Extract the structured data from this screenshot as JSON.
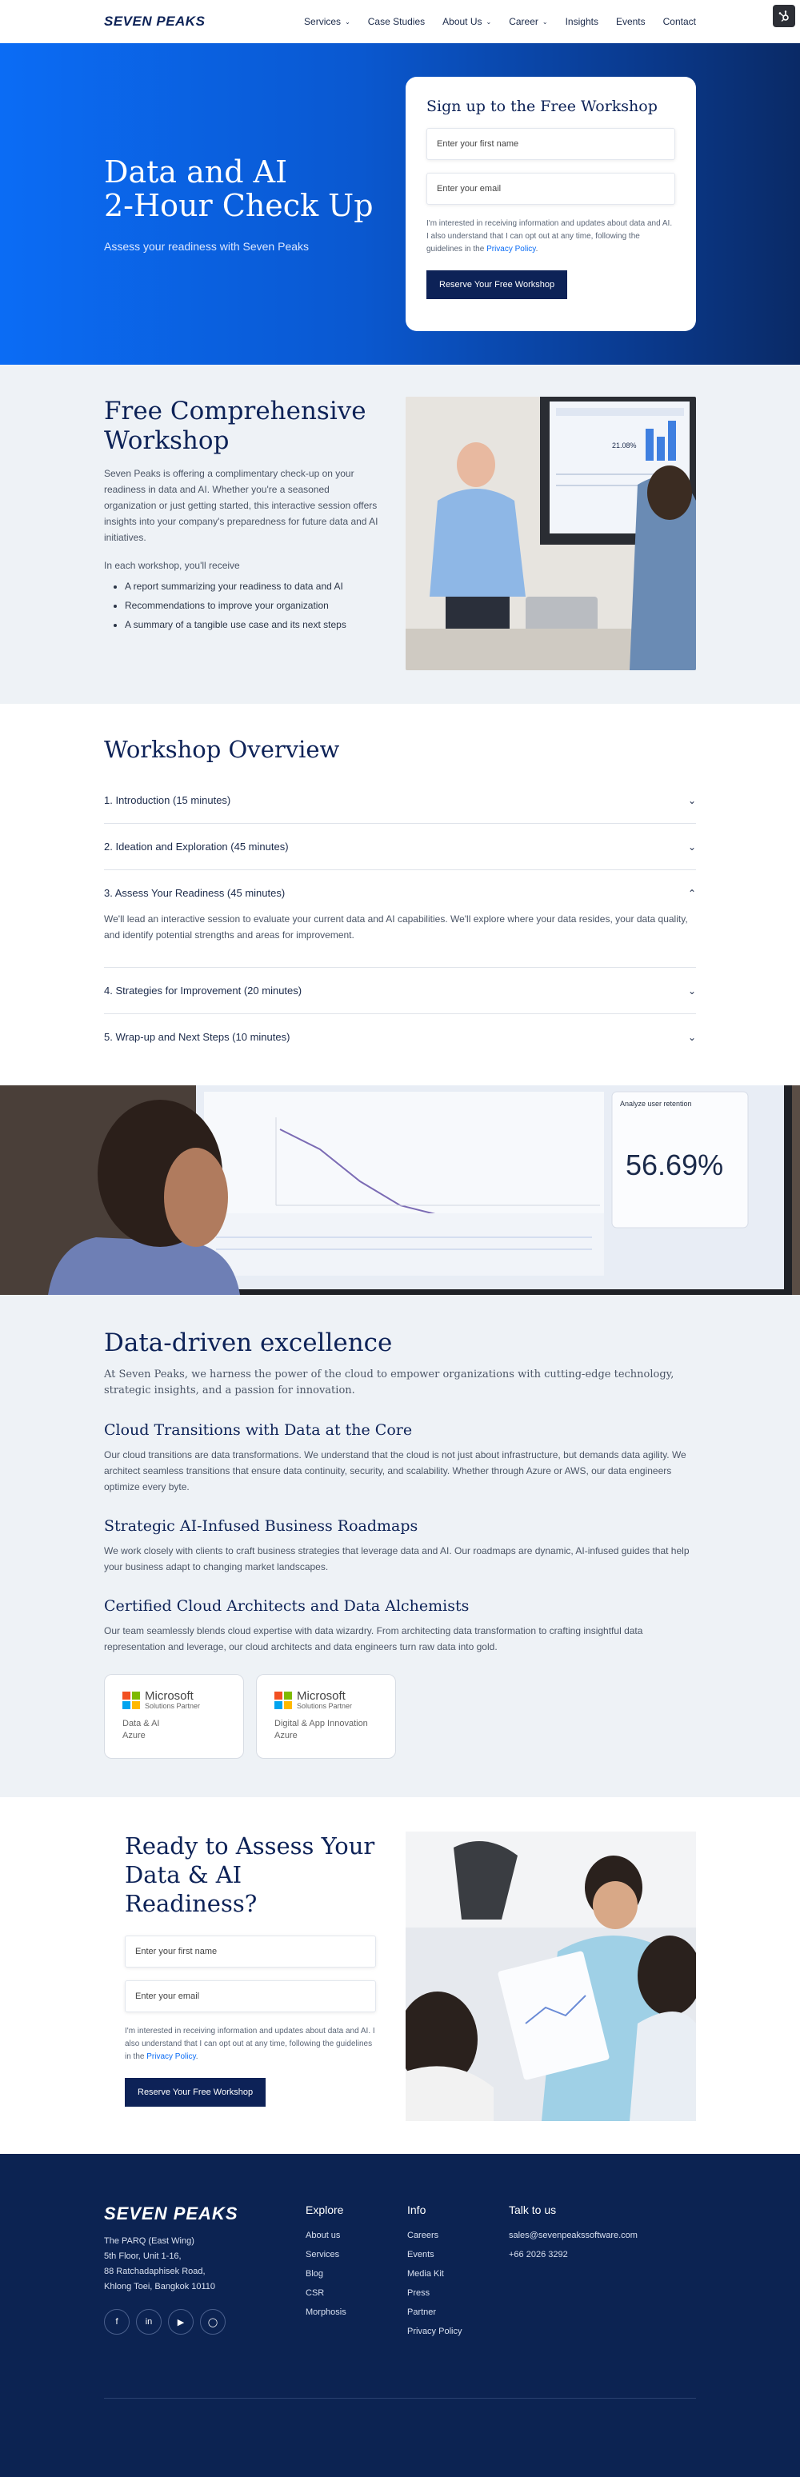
{
  "nav": {
    "logo": "SEVEN PEAKS",
    "items": [
      {
        "label": "Services",
        "dropdown": true
      },
      {
        "label": "Case Studies",
        "dropdown": false
      },
      {
        "label": "About Us",
        "dropdown": true
      },
      {
        "label": "Career",
        "dropdown": true
      },
      {
        "label": "Insights",
        "dropdown": false
      },
      {
        "label": "Events",
        "dropdown": false
      },
      {
        "label": "Contact",
        "dropdown": false
      }
    ]
  },
  "hero": {
    "title_line1": "Data and AI",
    "title_line2": "2-Hour Check Up",
    "subtitle": "Assess your readiness with Seven Peaks",
    "form": {
      "title": "Sign up to the Free Workshop",
      "first_name_placeholder": "Enter your first name",
      "email_placeholder": "Enter your email",
      "consent": "I'm interested in receiving information and updates about data and AI. I also understand that I can opt out at any time, following the guidelines in the ",
      "privacy_link": "Privacy Policy",
      "submit": "Reserve Your Free Workshop"
    }
  },
  "workshop": {
    "title_line1": "Free Comprehensive",
    "title_line2": "Workshop",
    "description": "Seven Peaks is offering a complimentary check-up on your readiness in data and AI. Whether you're a seasoned organization or just getting started, this interactive session offers insights into your company's preparedness for future data and AI initiatives.",
    "list_intro": "In each workshop, you'll receive",
    "items": [
      "A report summarizing your readiness to data and AI",
      "Recommendations to improve your organization",
      "A summary of a tangible use case and its next steps"
    ],
    "screen_stat": "21.08%"
  },
  "overview": {
    "title": "Workshop Overview",
    "sections": [
      {
        "title": "1. Introduction (15 minutes)",
        "open": false,
        "body": ""
      },
      {
        "title": "2. Ideation and Exploration (45 minutes)",
        "open": false,
        "body": ""
      },
      {
        "title": "3. Assess Your Readiness (45 minutes)",
        "open": true,
        "body": "We'll lead an interactive session to evaluate your current data and AI capabilities. We'll explore where your data resides, your data quality, and identify potential strengths and areas for improvement."
      },
      {
        "title": "4. Strategies for Improvement (20 minutes)",
        "open": false,
        "body": ""
      },
      {
        "title": "5. Wrap-up and Next Steps (10 minutes)",
        "open": false,
        "body": ""
      }
    ]
  },
  "banner": {
    "screen_stat": "56.69%",
    "screen_title": "Analyze user retention"
  },
  "data_driven": {
    "title": "Data-driven excellence",
    "intro": "At Seven Peaks, we harness the power of the cloud to empower organizations with cutting-edge technology, strategic insights, and a passion for innovation.",
    "blocks": [
      {
        "heading": "Cloud Transitions with Data at the Core",
        "text": "Our cloud transitions are data transformations. We understand that the cloud is not just about infrastructure, but demands data agility. We architect seamless transitions that ensure data continuity, security, and scalability. Whether through Azure or AWS, our data engineers optimize every byte."
      },
      {
        "heading": "Strategic AI-Infused Business Roadmaps",
        "text": "We work closely with clients to craft business strategies that leverage data and AI. Our roadmaps are dynamic, AI-infused guides that help your business adapt to changing market landscapes."
      },
      {
        "heading": "Certified Cloud Architects and Data Alchemists",
        "text": "Our team seamlessly blends cloud expertise with data wizardry. From architecting data transformation to crafting insightful data representation and leverage, our cloud architects and data engineers turn raw data into gold."
      }
    ],
    "badges": [
      {
        "brand": "Microsoft",
        "partner": "Solutions Partner",
        "line1": "Data & AI",
        "line2": "Azure"
      },
      {
        "brand": "Microsoft",
        "partner": "Solutions Partner",
        "line1": "Digital & App Innovation",
        "line2": "Azure"
      }
    ]
  },
  "ready": {
    "title_line1": "Ready to Assess Your",
    "title_line2": "Data & AI Readiness?",
    "first_name_placeholder": "Enter your first name",
    "email_placeholder": "Enter your email",
    "consent": "I'm interested in receiving information and updates about data and AI. I also understand that I can opt out at any time, following the guidelines in the ",
    "privacy_link": "Privacy Policy",
    "submit": "Reserve Your Free Workshop"
  },
  "footer": {
    "logo": "SEVEN PEAKS",
    "address": [
      "The PARQ (East Wing)",
      "5th Floor, Unit 1-16,",
      "88 Ratchadaphisek Road,",
      "Khlong Toei, Bangkok 10110"
    ],
    "social": [
      "facebook-icon",
      "linkedin-icon",
      "youtube-icon",
      "instagram-icon"
    ],
    "explore": {
      "heading": "Explore",
      "links": [
        "About us",
        "Services",
        "Blog",
        "CSR",
        "Morphosis"
      ]
    },
    "info": {
      "heading": "Info",
      "links": [
        "Careers",
        "Events",
        "Media Kit",
        "Press",
        "Partner",
        "Privacy Policy"
      ]
    },
    "talk": {
      "heading": "Talk to us",
      "links": [
        "sales@sevenpeakssoftware.com",
        "+66 2026 3292"
      ]
    }
  },
  "colors": {
    "brand_navy": "#0d2257",
    "accent_blue": "#0b6cf5",
    "footer_bg": "#0c2352",
    "section_bg": "#eef2f6"
  }
}
